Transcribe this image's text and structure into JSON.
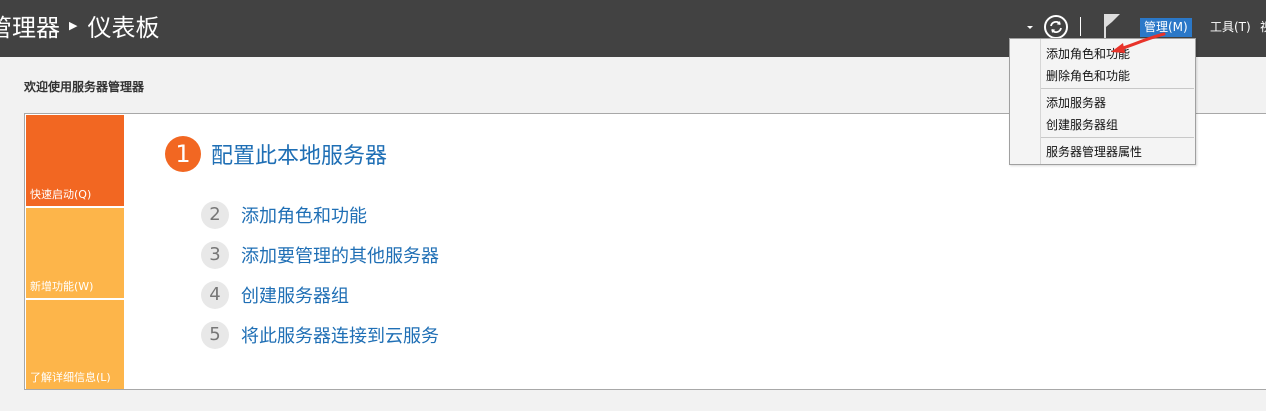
{
  "titlebar": {
    "breadcrumb_parent": "管理器",
    "breadcrumb_current": "仪表板",
    "menus": {
      "manage": "管理(M)",
      "tools": "工具(T)",
      "cut": "视"
    }
  },
  "welcome": {
    "title": "欢迎使用服务器管理器"
  },
  "tiles": {
    "quick_start": "快速启动(Q)",
    "whats_new": "新增功能(W)",
    "learn_more": "了解详细信息(L)"
  },
  "steps": [
    {
      "num": "1",
      "label": "配置此本地服务器"
    },
    {
      "num": "2",
      "label": "添加角色和功能"
    },
    {
      "num": "3",
      "label": "添加要管理的其他服务器"
    },
    {
      "num": "4",
      "label": "创建服务器组"
    },
    {
      "num": "5",
      "label": "将此服务器连接到云服务"
    }
  ],
  "manage_menu": {
    "items": [
      "添加角色和功能",
      "删除角色和功能",
      "添加服务器",
      "创建服务器组",
      "服务器管理器属性"
    ]
  },
  "colors": {
    "titlebar": "#424242",
    "accent_orange": "#f26722",
    "tile_yellow": "#fdb54a",
    "link_blue": "#1f6fb5",
    "menu_highlight": "#2b78c8",
    "annotation_arrow": "#e8332a"
  },
  "icons": {
    "dropdown": "caret-down-icon",
    "refresh": "refresh-icon",
    "flag": "notification-flag-icon",
    "annotation": "red-arrow-icon"
  }
}
